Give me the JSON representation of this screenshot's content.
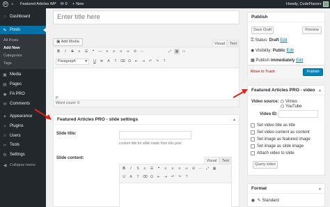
{
  "adminbar": {
    "site_name": "Featured Articles WP",
    "comments_count": "0",
    "new_label": "New",
    "greeting": "Howdy, CodeFlavors"
  },
  "sidebar": {
    "items": [
      {
        "label": "Dashboard",
        "icon": "dashboard-icon",
        "glyph": "⌂"
      },
      {
        "label": "Posts",
        "icon": "pin-icon",
        "glyph": "✎"
      },
      {
        "label": "Media",
        "icon": "media-icon",
        "glyph": "▣"
      },
      {
        "label": "Pages",
        "icon": "pages-icon",
        "glyph": "▤"
      },
      {
        "label": "FA PRO",
        "icon": "plugin-icon",
        "glyph": "◆"
      },
      {
        "label": "Comments",
        "icon": "comments-icon",
        "glyph": "✉"
      },
      {
        "label": "Appearance",
        "icon": "appearance-icon",
        "glyph": "✦"
      },
      {
        "label": "Plugins",
        "icon": "plugins-icon",
        "glyph": "⚡"
      },
      {
        "label": "Users",
        "icon": "users-icon",
        "glyph": "☺"
      },
      {
        "label": "Tools",
        "icon": "tools-icon",
        "glyph": "✂"
      },
      {
        "label": "Settings",
        "icon": "settings-icon",
        "glyph": "⚙"
      }
    ],
    "submenu": [
      "All Posts",
      "Add New",
      "Categories",
      "Tags"
    ],
    "collapse_label": "Collapse menu"
  },
  "title_placeholder": "Enter title here",
  "editor": {
    "add_media": "Add Media",
    "tab_visual": "Visual",
    "tab_text": "Text",
    "format_select": "Paragraph",
    "path": "P",
    "word_count": "Word count: 0"
  },
  "slide_settings": {
    "title": "Featured Articles PRO - slide settings",
    "slide_title_label": "Slide title:",
    "slide_title_hint": "custom title for slide made from this post",
    "slide_content_label": "Slide content:",
    "tab_visual": "Visual",
    "tab_text": "Text"
  },
  "publish": {
    "title": "Publish",
    "save_draft": "Save Draft",
    "preview": "Preview",
    "status_label": "Status:",
    "status_value": "Draft",
    "visibility_label": "Visibility:",
    "visibility_value": "Public",
    "publish_label": "Publish",
    "publish_value": "immediately",
    "edit": "Edit",
    "trash": "Move to Trash",
    "publish_button": "Publish"
  },
  "video_box": {
    "title": "Featured Articles PRO - video",
    "source_label": "Video source:",
    "source_options": [
      "Vimeo",
      "YouTube"
    ],
    "video_id_label": "Video ID:",
    "checkboxes": [
      "Set video title as title",
      "Set video content as content",
      "Set image as featured image",
      "Set image as slide image",
      "Attach video to slide"
    ],
    "query_button": "Query video"
  },
  "format_box": {
    "title": "Format",
    "option": "Standard"
  },
  "colors": {
    "admin_dark": "#23282d",
    "accent_blue": "#0073aa",
    "arrow_red": "#e2231a"
  }
}
